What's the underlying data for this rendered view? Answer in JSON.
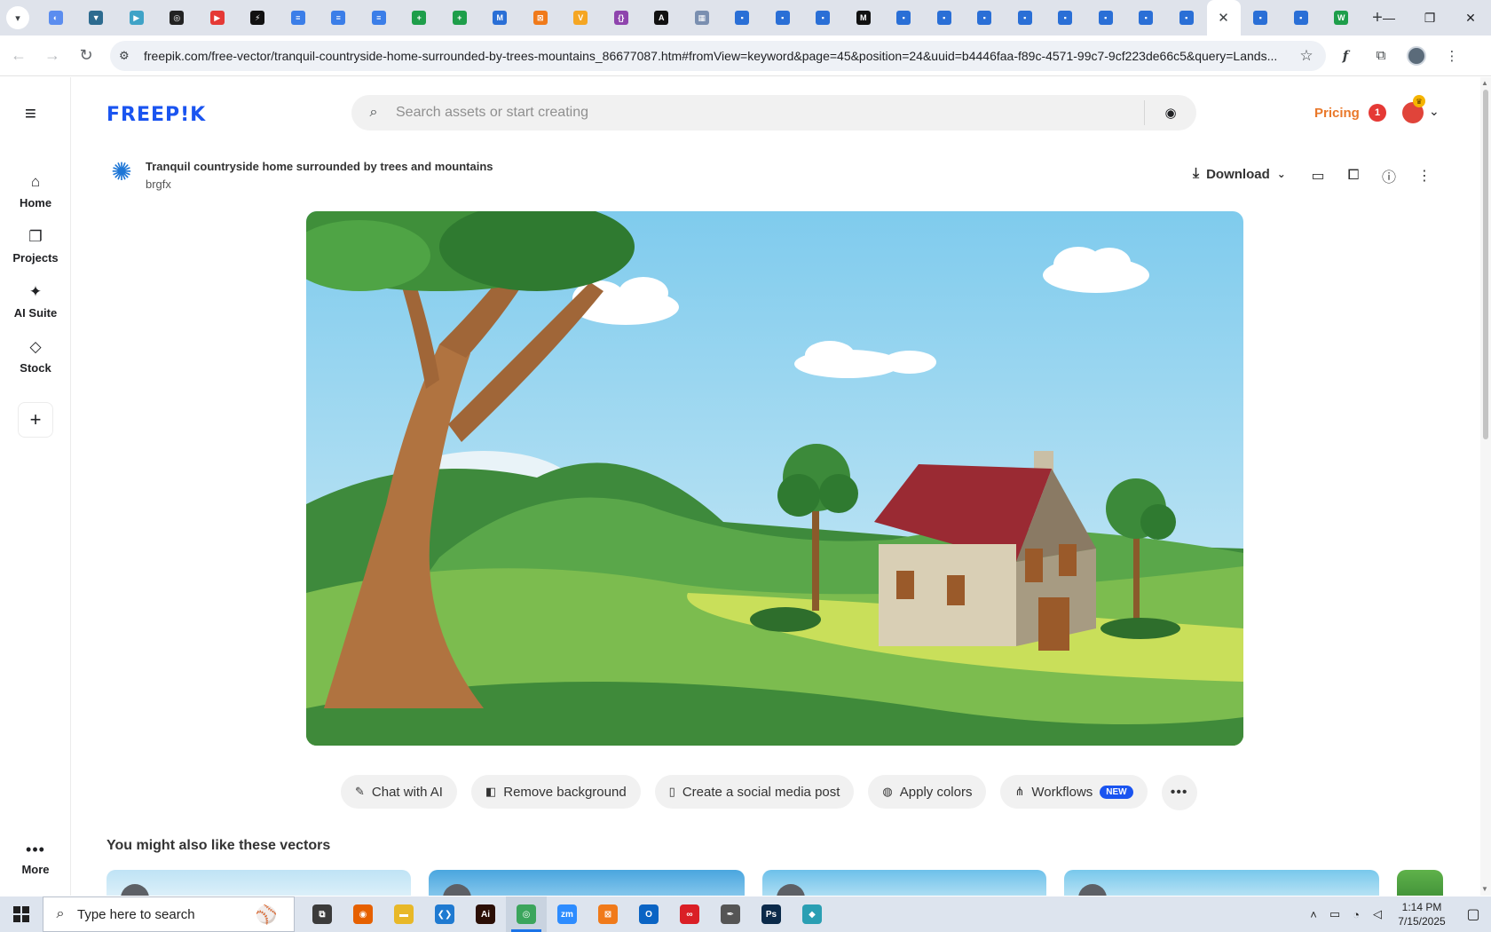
{
  "browser": {
    "tabs": [
      {
        "name": "tab-1",
        "glyph": "◐",
        "color": "#5b8def"
      },
      {
        "name": "tab-2",
        "glyph": "▼",
        "color": "#2d6b8f"
      },
      {
        "name": "tab-3",
        "glyph": "▶",
        "color": "#3fa3c7"
      },
      {
        "name": "tab-4",
        "glyph": "◎",
        "color": "#222222"
      },
      {
        "name": "tab-5",
        "glyph": "▶",
        "color": "#e53935"
      },
      {
        "name": "tab-6",
        "glyph": "⚡",
        "color": "#111111"
      },
      {
        "name": "tab-7",
        "glyph": "≡",
        "color": "#3b7ee8"
      },
      {
        "name": "tab-8",
        "glyph": "≡",
        "color": "#3b7ee8"
      },
      {
        "name": "tab-9",
        "glyph": "≡",
        "color": "#3b7ee8"
      },
      {
        "name": "tab-10",
        "glyph": "+",
        "color": "#1e9e4a"
      },
      {
        "name": "tab-11",
        "glyph": "+",
        "color": "#1e9e4a"
      },
      {
        "name": "tab-12",
        "glyph": "M",
        "color": "#2a6fd6"
      },
      {
        "name": "tab-13",
        "glyph": "⊠",
        "color": "#f07a1a"
      },
      {
        "name": "tab-14",
        "glyph": "V",
        "color": "#f5a623"
      },
      {
        "name": "tab-15",
        "glyph": "{}",
        "color": "#8e44ad"
      },
      {
        "name": "tab-16",
        "glyph": "A",
        "color": "#111111"
      },
      {
        "name": "tab-17",
        "glyph": "▦",
        "color": "#7a8fb0"
      },
      {
        "name": "tab-18",
        "glyph": "▪",
        "color": "#2a6fd6"
      },
      {
        "name": "tab-19",
        "glyph": "▪",
        "color": "#2a6fd6"
      },
      {
        "name": "tab-20",
        "glyph": "▪",
        "color": "#2a6fd6"
      },
      {
        "name": "tab-21",
        "glyph": "M",
        "color": "#111111"
      },
      {
        "name": "tab-22",
        "glyph": "▪",
        "color": "#2a6fd6"
      },
      {
        "name": "tab-23",
        "glyph": "▪",
        "color": "#2a6fd6"
      },
      {
        "name": "tab-24",
        "glyph": "▪",
        "color": "#2a6fd6"
      },
      {
        "name": "tab-25",
        "glyph": "▪",
        "color": "#2a6fd6"
      },
      {
        "name": "tab-26",
        "glyph": "▪",
        "color": "#2a6fd6"
      },
      {
        "name": "tab-27",
        "glyph": "▪",
        "color": "#2a6fd6"
      },
      {
        "name": "tab-28",
        "glyph": "▪",
        "color": "#2a6fd6"
      },
      {
        "name": "tab-29",
        "glyph": "▪",
        "color": "#2a6fd6"
      }
    ],
    "tabs_after": [
      {
        "name": "tab-31",
        "glyph": "▪",
        "color": "#2a6fd6"
      },
      {
        "name": "tab-32",
        "glyph": "▪",
        "color": "#2a6fd6"
      },
      {
        "name": "tab-33",
        "glyph": "W",
        "color": "#1e9e4a"
      }
    ],
    "url": "freepik.com/free-vector/tranquil-countryside-home-surrounded-by-trees-mountains_86677087.htm#fromView=keyword&page=45&position=24&uuid=b4446faa-f89c-4571-99c7-9cf223de66c5&query=Lands..."
  },
  "sidebar": {
    "items": [
      {
        "label": "Home",
        "icon": "home-icon",
        "glyph": "⌂"
      },
      {
        "label": "Projects",
        "icon": "projects-icon",
        "glyph": "❐"
      },
      {
        "label": "AI Suite",
        "icon": "sparkle-icon",
        "glyph": "✦"
      },
      {
        "label": "Stock",
        "icon": "stock-icon",
        "glyph": "◇"
      }
    ],
    "more_label": "More"
  },
  "header": {
    "logo": "FREEP!K",
    "search_placeholder": "Search assets or start creating",
    "pricing": "Pricing",
    "notification_count": "1"
  },
  "asset": {
    "title": "Tranquil countryside home surrounded by trees and mountains",
    "author": "brgfx",
    "download_label": "Download"
  },
  "chips": [
    {
      "label": "Chat with AI",
      "icon": "chat-icon",
      "glyph": "✎"
    },
    {
      "label": "Remove background",
      "icon": "remove-bg-icon",
      "glyph": "◧"
    },
    {
      "label": "Create a social media post",
      "icon": "phone-icon",
      "glyph": "▯"
    },
    {
      "label": "Apply colors",
      "icon": "palette-icon",
      "glyph": "◍"
    },
    {
      "label": "Workflows",
      "icon": "workflow-icon",
      "glyph": "⋔",
      "badge": "NEW"
    }
  ],
  "related": {
    "heading": "You might also like these vectors"
  },
  "taskbar": {
    "search_text": "Type here to search",
    "apps": [
      {
        "name": "task-view",
        "glyph": "⧉",
        "color": "#3b3b3b"
      },
      {
        "name": "firefox",
        "glyph": "◉",
        "color": "#e66000"
      },
      {
        "name": "file-explorer",
        "glyph": "▬",
        "color": "#e8b828"
      },
      {
        "name": "vscode",
        "glyph": "❮❯",
        "color": "#1f7ad1"
      },
      {
        "name": "illustrator",
        "glyph": "Ai",
        "color": "#2b0f06"
      },
      {
        "name": "chrome",
        "glyph": "◎",
        "color": "#3ba55c"
      },
      {
        "name": "zoom",
        "glyph": "zm",
        "color": "#2d8cff"
      },
      {
        "name": "xampp",
        "glyph": "⊠",
        "color": "#f07a1a"
      },
      {
        "name": "outlook",
        "glyph": "O",
        "color": "#0a64c4"
      },
      {
        "name": "creative-cloud",
        "glyph": "∞",
        "color": "#da1f26"
      },
      {
        "name": "pen-tool",
        "glyph": "✒",
        "color": "#555555"
      },
      {
        "name": "photoshop",
        "glyph": "Ps",
        "color": "#0b2a4a"
      },
      {
        "name": "app-diamond",
        "glyph": "◆",
        "color": "#2a9fb3"
      }
    ],
    "time": "1:14 PM",
    "date": "7/15/2025"
  }
}
